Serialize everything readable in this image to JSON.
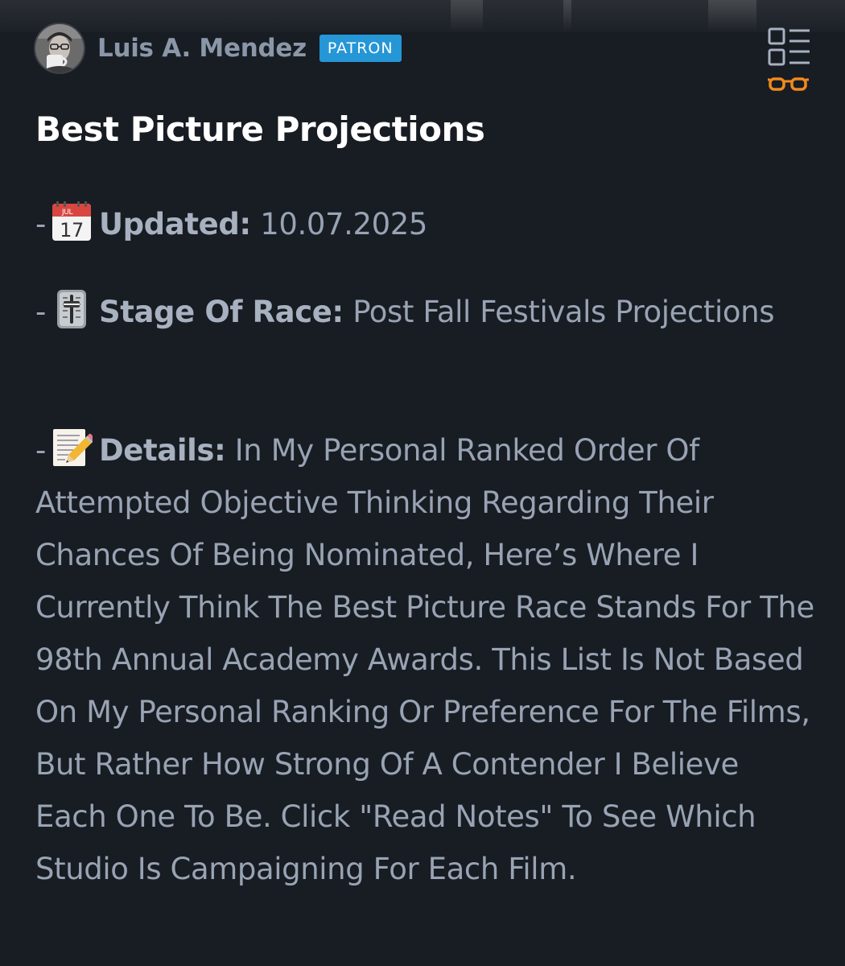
{
  "author": {
    "name": "Luis A. Mendez",
    "badge": "PATRON"
  },
  "post": {
    "title": "Best Picture Projections",
    "bullet": "-",
    "updated": {
      "icon": "calendar-icon",
      "calendar_month": "JUL",
      "calendar_day": "17",
      "label": "Updated:",
      "value": "10.07.2025"
    },
    "stage": {
      "icon": "level-slider-icon",
      "label": "Stage Of Race:",
      "value": "Post Fall Festivals Projections"
    },
    "details": {
      "icon": "memo-pencil-icon",
      "label": "Details:",
      "value": "In My Personal Ranked Order Of Attempted Objective Thinking Regarding Their Chances Of Being Nominated, Here’s Where I Currently Think The Best Picture Race Stands For The 98th Annual Academy Awards. This List Is Not Based On My Personal Ranking Or Preference For The Films, But Rather How Strong Of A Contender I Believe Each One To Be. Click \"Read Notes\" To See Which Studio Is Campaigning For Each Film."
    }
  },
  "toolbar": {
    "reader_icon": "reader-view-list-glasses-icon"
  },
  "colors": {
    "background": "#181c23",
    "badge": "#2596d6",
    "accent_orange": "#f08a1c",
    "text_muted": "#98a3b3"
  }
}
